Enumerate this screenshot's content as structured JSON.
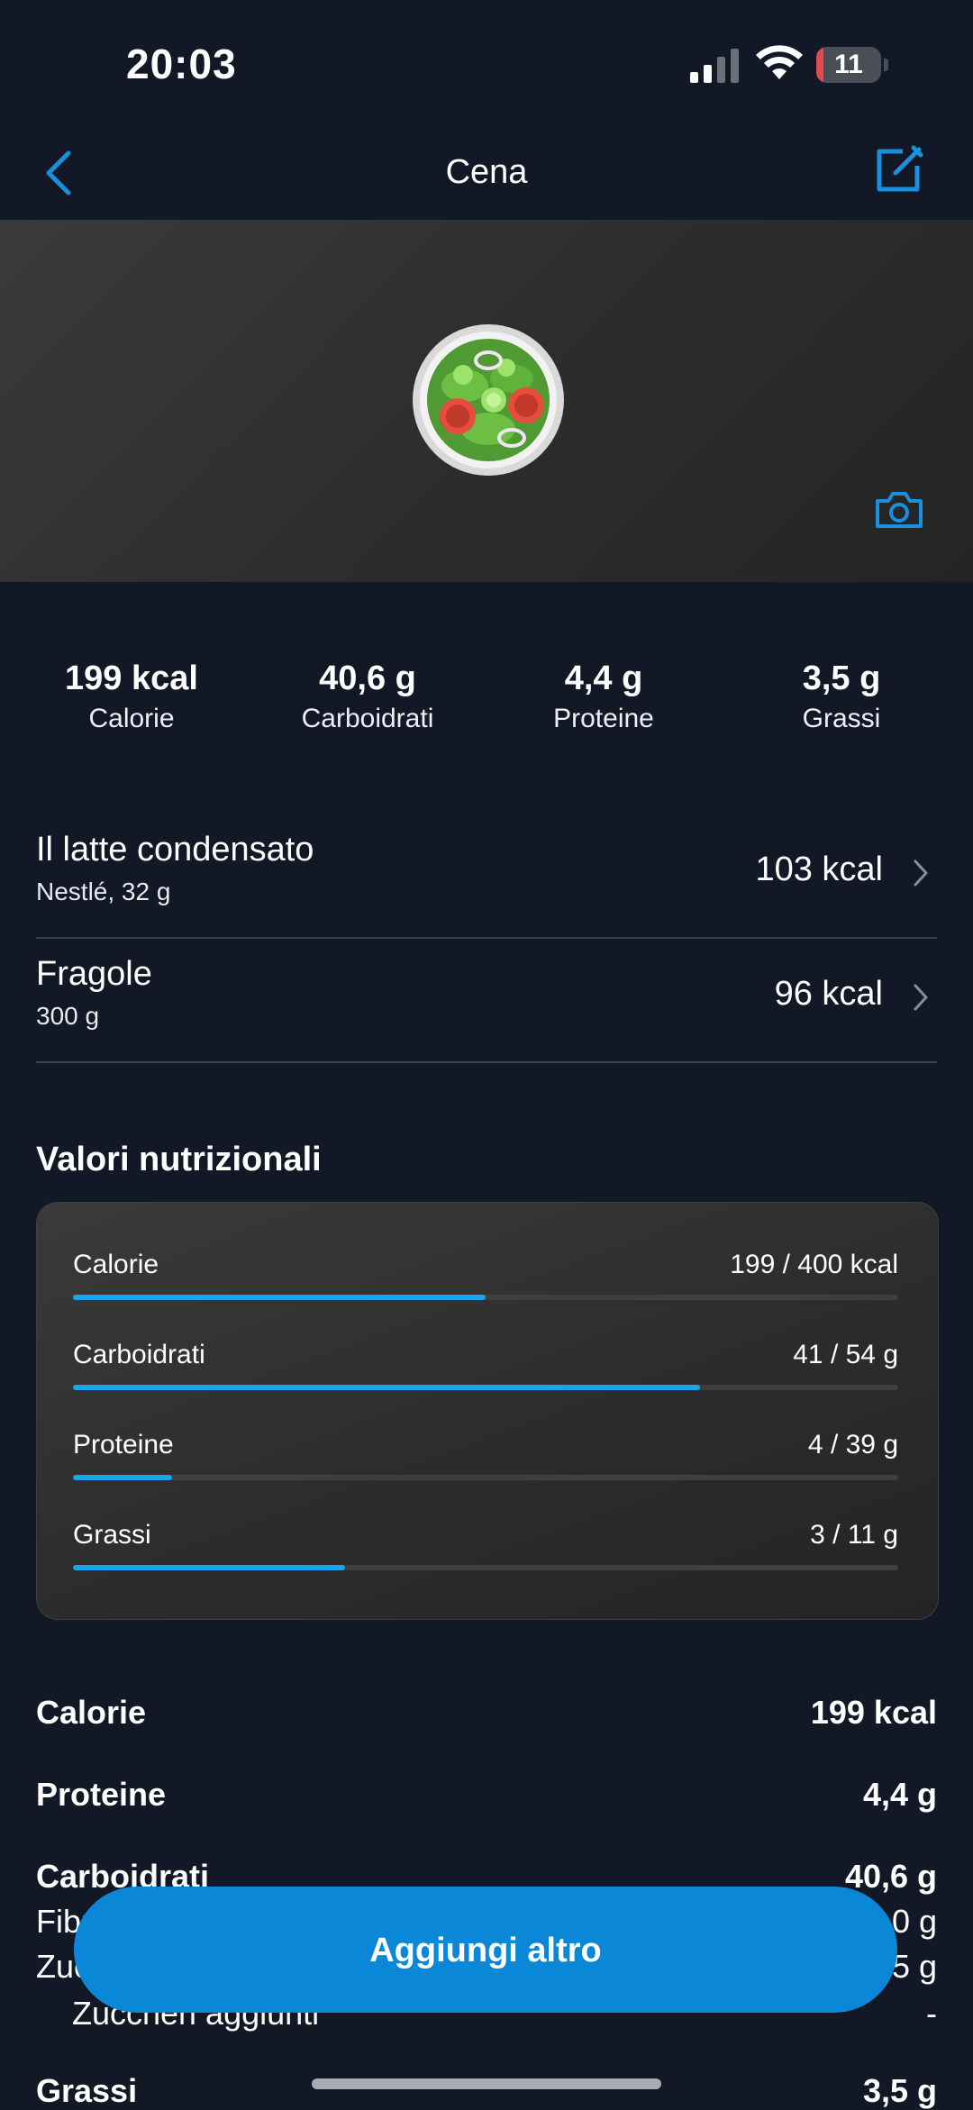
{
  "status_bar": {
    "time": "20:03",
    "battery": "11",
    "battery_level": 0.11
  },
  "nav": {
    "title": "Cena",
    "back_icon": "chevron-left-icon",
    "edit_icon": "edit-icon"
  },
  "hero": {
    "food_icon": "salad-icon",
    "camera_icon": "camera-icon"
  },
  "summary": [
    {
      "value": "199 kcal",
      "label": "Calorie"
    },
    {
      "value": "40,6 g",
      "label": "Carboidrati"
    },
    {
      "value": "4,4 g",
      "label": "Proteine"
    },
    {
      "value": "3,5 g",
      "label": "Grassi"
    }
  ],
  "foods": [
    {
      "name": "Il latte condensato",
      "detail": "Nestlé, 32 g",
      "kcal": "103 kcal"
    },
    {
      "name": "Fragole",
      "detail": "300 g",
      "kcal": "96 kcal"
    }
  ],
  "nutrition": {
    "title": "Valori nutrizionali",
    "bars": [
      {
        "label": "Calorie",
        "value": "199 / 400 kcal",
        "progress": 0.5
      },
      {
        "label": "Carboidrati",
        "value": "41 / 54 g",
        "progress": 0.76
      },
      {
        "label": "Proteine",
        "value": "4 / 39 g",
        "progress": 0.12
      },
      {
        "label": "Grassi",
        "value": "3 / 11 g",
        "progress": 0.33
      }
    ]
  },
  "details": {
    "calories": {
      "label": "Calorie",
      "value": "199 kcal"
    },
    "protein": {
      "label": "Proteine",
      "value": "4,4 g"
    },
    "carbs": {
      "label": "Carboidrati",
      "value": "40,6 g"
    },
    "fiber": {
      "label": "Fibre",
      "value": "0 g"
    },
    "sugars": {
      "label": "Zuccheri",
      "value": "5 g"
    },
    "added_sugars": {
      "label": "Zuccheri aggiunti",
      "value": "-"
    },
    "fat": {
      "label": "Grassi",
      "value": "3,5 g"
    }
  },
  "cta": {
    "label": "Aggiungi altro"
  },
  "colors": {
    "background": "#131826",
    "accent": "#0a87d6",
    "bar": "#1aa4ee",
    "card": "#2e2e2e"
  }
}
